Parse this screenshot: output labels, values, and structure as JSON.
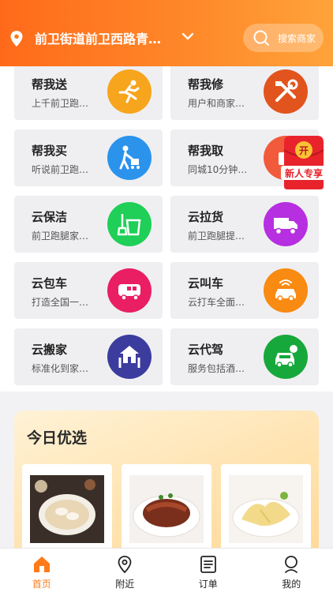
{
  "header": {
    "location_text": "前卫街道前卫西路青…",
    "search_placeholder": "搜索商家"
  },
  "services": [
    {
      "title": "帮我送",
      "subtitle": "上千前卫跑…",
      "icon": "runner-icon",
      "color": "#f7a51c"
    },
    {
      "title": "帮我修",
      "subtitle": "用户和商家…",
      "icon": "repair-tools-icon",
      "color": "#e2541d"
    },
    {
      "title": "帮我买",
      "subtitle": "听说前卫跑…",
      "icon": "shopping-cart-icon",
      "color": "#2b93ec"
    },
    {
      "title": "帮我取",
      "subtitle": "同城10分钟…",
      "icon": "pickup-icon",
      "color": "#f15b3c"
    },
    {
      "title": "云保洁",
      "subtitle": "前卫跑腿家…",
      "icon": "cleaning-bucket-icon",
      "color": "#1fcf57"
    },
    {
      "title": "云拉货",
      "subtitle": "前卫跑腿提…",
      "icon": "truck-icon",
      "color": "#b62fe0"
    },
    {
      "title": "云包车",
      "subtitle": "打造全国一…",
      "icon": "bus-icon",
      "color": "#e91e63"
    },
    {
      "title": "云叫车",
      "subtitle": "云打车全面…",
      "icon": "taxi-icon",
      "color": "#f98a12"
    },
    {
      "title": "云搬家",
      "subtitle": "标准化到家…",
      "icon": "moving-house-icon",
      "color": "#3b3c9e"
    },
    {
      "title": "云代驾",
      "subtitle": "服务包括酒…",
      "icon": "designated-driver-icon",
      "color": "#17a83b"
    }
  ],
  "promo": {
    "top_text": "开",
    "label": "新人专享",
    "color": "#e8232c"
  },
  "today": {
    "title": "今日优选",
    "items": [
      {
        "icon": "dumpling-soup-dish-icon"
      },
      {
        "icon": "braised-pork-dish-icon"
      },
      {
        "icon": "chicken-dish-icon"
      }
    ]
  },
  "tabs": [
    {
      "label": "首页",
      "icon": "home-icon",
      "active": true
    },
    {
      "label": "附近",
      "icon": "location-pin-icon",
      "active": false
    },
    {
      "label": "订单",
      "icon": "order-list-icon",
      "active": false
    },
    {
      "label": "我的",
      "icon": "profile-icon",
      "active": false
    }
  ],
  "colors": {
    "accent": "#ff7a1a",
    "header_start": "#ff6a1a",
    "header_end": "#ffa33a"
  }
}
